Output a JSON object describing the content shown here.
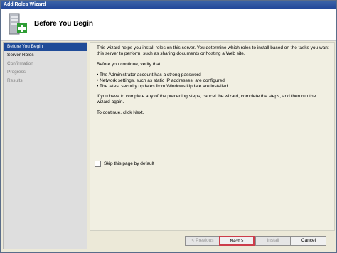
{
  "window": {
    "title": "Add Roles Wizard"
  },
  "header": {
    "title": "Before You Begin",
    "icon": "server-add-icon"
  },
  "sidebar": {
    "items": [
      {
        "label": "Before You Begin",
        "state": "active"
      },
      {
        "label": "Server Roles",
        "state": "normal"
      },
      {
        "label": "Confirmation",
        "state": "disabled"
      },
      {
        "label": "Progress",
        "state": "disabled"
      },
      {
        "label": "Results",
        "state": "disabled"
      }
    ]
  },
  "content": {
    "intro": "This wizard helps you install roles on this server. You determine which roles to install based on the tasks you want this server to perform, such as sharing documents or hosting a Web site.",
    "verify_label": "Before you continue, verify that:",
    "bullets": [
      "The Administrator account has a strong password",
      "Network settings, such as static IP addresses, are configured",
      "The latest security updates from Windows Update are installed"
    ],
    "complete_text": "If you have to complete any of the preceding steps, cancel the wizard, complete the steps, and then run the wizard again.",
    "continue_text": "To continue, click Next.",
    "skip_label": "Skip this page by default"
  },
  "buttons": {
    "previous": "< Previous",
    "next": "Next >",
    "install": "Install",
    "cancel": "Cancel"
  }
}
